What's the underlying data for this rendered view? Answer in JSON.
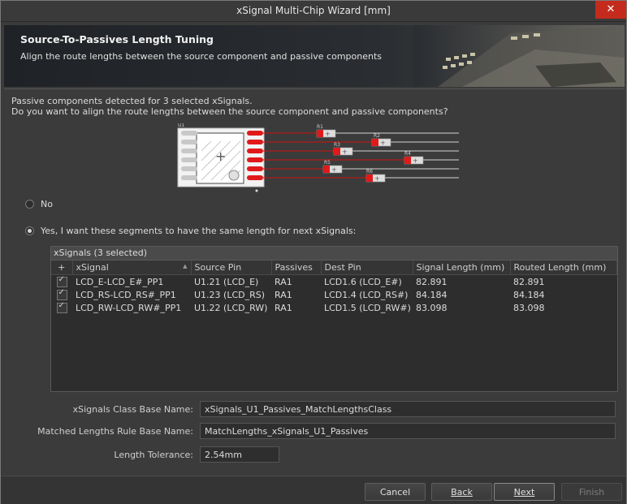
{
  "window": {
    "title": "xSignal Multi-Chip Wizard [mm]",
    "close_glyph": "✕"
  },
  "header": {
    "title": "Source-To-Passives Length Tuning",
    "subtitle": "Align the route lengths between the source component and passive components"
  },
  "intro": {
    "line1": "Passive components detected for 3 selected xSignals.",
    "line2": "Do you want to align the route lengths between the source component and passive components?"
  },
  "diagram": {
    "component_label": "U1",
    "resistors": [
      "R1",
      "R2",
      "R3",
      "R4",
      "R5",
      "R6"
    ]
  },
  "options": {
    "no_label": "No",
    "yes_label": "Yes, I want these segments to have the same length for next xSignals:",
    "selected": "yes"
  },
  "grid": {
    "caption": "xSignals (3 selected)",
    "columns": [
      "+",
      "xSignal",
      "Source Pin",
      "Passives",
      "Dest Pin",
      "Signal Length (mm)",
      "Routed Length (mm)"
    ],
    "rows": [
      {
        "checked": true,
        "xsignal": "LCD_E-LCD_E#_PP1",
        "source_pin": "U1.21 (LCD_E)",
        "passives": "RA1",
        "dest_pin": "LCD1.6 (LCD_E#)",
        "signal_length": "82.891",
        "routed_length": "82.891"
      },
      {
        "checked": true,
        "xsignal": "LCD_RS-LCD_RS#_PP1",
        "source_pin": "U1.23 (LCD_RS)",
        "passives": "RA1",
        "dest_pin": "LCD1.4 (LCD_RS#)",
        "signal_length": "84.184",
        "routed_length": "84.184"
      },
      {
        "checked": true,
        "xsignal": "LCD_RW-LCD_RW#_PP1",
        "source_pin": "U1.22 (LCD_RW)",
        "passives": "RA1",
        "dest_pin": "LCD1.5 (LCD_RW#)",
        "signal_length": "83.098",
        "routed_length": "83.098"
      }
    ]
  },
  "fields": {
    "class_label": "xSignals Class Base Name:",
    "class_value": "xSignals_U1_Passives_MatchLengthsClass",
    "rule_label": "Matched Lengths Rule Base Name:",
    "rule_value": "MatchLengths_xSignals_U1_Passives",
    "tolerance_label": "Length Tolerance:",
    "tolerance_value": "2.54mm"
  },
  "buttons": {
    "cancel": "Cancel",
    "back": "Back",
    "next": "Next",
    "finish": "Finish"
  },
  "colors": {
    "accent_red": "#e01a1a",
    "trace_red": "#d01010",
    "close_red": "#c42b1c"
  }
}
